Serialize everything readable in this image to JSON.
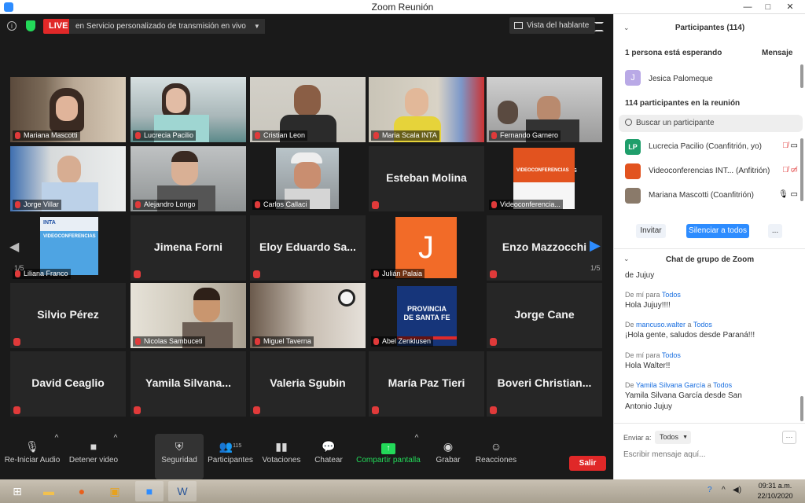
{
  "window": {
    "title": "Zoom Reunión",
    "buttons": [
      "—",
      "□",
      "✕"
    ]
  },
  "top_bar": {
    "live_label": "LIVE",
    "live_service": "en Servicio personalizado de transmisión en vivo",
    "view_label": "Vista del hablante"
  },
  "gallery": {
    "page_left": "1/5",
    "page_right": "1/5",
    "tiles": [
      {
        "name": "Mariana Mascotti",
        "big": ""
      },
      {
        "name": "Lucrecia Pacilio",
        "big": ""
      },
      {
        "name": "Cristian Leon",
        "big": ""
      },
      {
        "name": "Maria Scala INTA",
        "big": ""
      },
      {
        "name": "Fernando Garnero",
        "big": ""
      },
      {
        "name": "Jorge Villar",
        "big": ""
      },
      {
        "name": "Alejandro Longo",
        "big": ""
      },
      {
        "name": "Carlos Callaci",
        "big": ""
      },
      {
        "name": "",
        "big": "Esteban Molina"
      },
      {
        "name": "Videoconferencia...",
        "big": ""
      },
      {
        "name": "Liliana Franco",
        "big": ""
      },
      {
        "name": "",
        "big": "Jimena Forni"
      },
      {
        "name": "",
        "big": "Eloy Eduardo Sa..."
      },
      {
        "name": "Julián Palaia",
        "big": ""
      },
      {
        "name": "",
        "big": "Enzo Mazzocchi"
      },
      {
        "name": "",
        "big": "Silvio Pérez"
      },
      {
        "name": "Nicolas Sambuceti",
        "big": ""
      },
      {
        "name": "Miguel Taverna",
        "big": ""
      },
      {
        "name": "Abel Zenklusen",
        "big": ""
      },
      {
        "name": "",
        "big": "Jorge Cane"
      },
      {
        "name": "",
        "big": "David Ceaglio"
      },
      {
        "name": "",
        "big": "Yamila Silvana..."
      },
      {
        "name": "",
        "big": "Valeria Sgubin"
      },
      {
        "name": "",
        "big": "María Paz Tieri"
      },
      {
        "name": "",
        "big": "Boveri Christian..."
      }
    ],
    "slide_brand": "INTA",
    "slide_title": "VIDEOCONFERENCIAS",
    "avatar_letter": "J",
    "santafe_line1": "PROVINCIA",
    "santafe_line2": "DE SANTA FE"
  },
  "toolbar": {
    "audio": "Re-Iniciar Audio",
    "video": "Detener video",
    "security": "Seguridad",
    "participants": "Participantes",
    "participants_count": "115",
    "polls": "Votaciones",
    "chat": "Chatear",
    "share": "Compartir pantalla",
    "record": "Grabar",
    "reactions": "Reacciones",
    "leave": "Salir"
  },
  "participants_panel": {
    "title": "Participantes (114)",
    "waiting_text": "1 persona está esperando",
    "message_link": "Mensaje",
    "waiting_person": {
      "initial": "J",
      "name": "Jesica Palomeque"
    },
    "in_meeting": "114 participantes en la reunión",
    "search_placeholder": "Buscar un participante",
    "rows": [
      {
        "initials": "LP",
        "name": "Lucrecia Pacilio (Coanfitrión, yo)",
        "color": "#1f9e6b"
      },
      {
        "initials": "",
        "name": "Videoconferencias INT... (Anfitrión)",
        "color": "#e2531f"
      },
      {
        "initials": "",
        "name": "Mariana Mascotti (Coanfitrión)",
        "color": "#8a7a6a"
      }
    ],
    "invite": "Invitar",
    "mute_all": "Silenciar a todos",
    "more": "..."
  },
  "chat_panel": {
    "title": "Chat de grupo de Zoom",
    "messages": [
      {
        "meta_prefix": "",
        "from": "",
        "mid": "",
        "to": "",
        "text": "de Jujuy"
      },
      {
        "meta_prefix": "De mí para ",
        "from": "",
        "mid": "",
        "to": "Todos",
        "text": "Hola Jujuy!!!!"
      },
      {
        "meta_prefix": "De ",
        "from": "mancuso.walter",
        "mid": " a ",
        "to": "Todos",
        "text": "¡Hola gente, saludos desde Paraná!!!"
      },
      {
        "meta_prefix": "De mí para ",
        "from": "",
        "mid": "",
        "to": "Todos",
        "text": "Hola Walter!!"
      },
      {
        "meta_prefix": "De ",
        "from": "Yamila Silvana García",
        "mid": " a ",
        "to": "Todos",
        "text": "Yamila Silvana García  desde San Antonio Jujuy"
      }
    ],
    "send_to_label": "Enviar a:",
    "send_to_value": "Todos",
    "input_placeholder": "Escribir mensaje aquí..."
  },
  "taskbar": {
    "time": "09:31 a.m.",
    "date": "22/10/2020"
  },
  "colors": {
    "accent": "#2d8cff",
    "live": "#e02828",
    "share": "#23d959",
    "active_speaker": "#c9e05a"
  }
}
